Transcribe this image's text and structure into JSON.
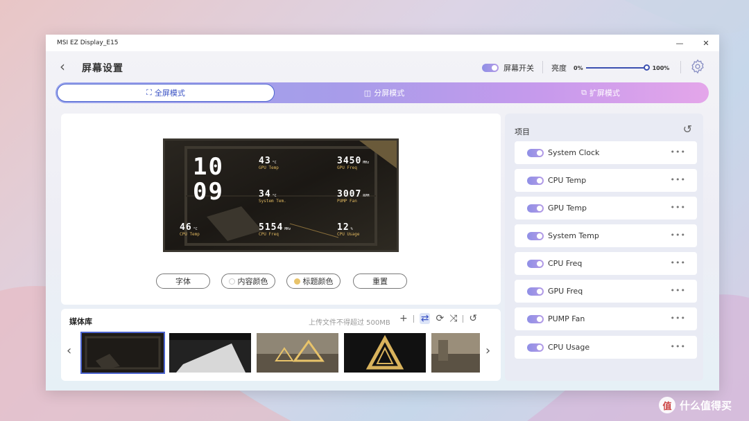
{
  "window": {
    "title": "MSI EZ Display_E15",
    "minimize": "—",
    "close": "✕"
  },
  "header": {
    "back": "‹",
    "title": "屏幕设置",
    "screen_switch_label": "屏幕开关",
    "brightness_label": "亮度",
    "brightness_min": "0%",
    "brightness_max": "100%",
    "brightness_value": 1.0
  },
  "tabs": [
    {
      "label": "全屏模式",
      "icon": "fullscreen-icon",
      "active": true
    },
    {
      "label": "分屏模式",
      "icon": "split-icon",
      "active": false
    },
    {
      "label": "扩屏模式",
      "icon": "extend-icon",
      "active": false
    }
  ],
  "preview": {
    "clock_hour": "10",
    "clock_min": "09",
    "stats": [
      {
        "value": "43",
        "unit": "°C",
        "label": "GPU Temp"
      },
      {
        "value": "3450",
        "unit": "MHz",
        "label": "GPU Freq"
      },
      {
        "value": "34",
        "unit": "°C",
        "label": "System Tem."
      },
      {
        "value": "3007",
        "unit": "RPM",
        "label": "PUMP Fan"
      },
      {
        "value": "46",
        "unit": "°C",
        "label": "CPU Temp"
      },
      {
        "value": "5154",
        "unit": "MHz",
        "label": "CPU Freq"
      },
      {
        "value": "12",
        "unit": "%",
        "label": "CPU Usage"
      }
    ],
    "buttons": {
      "font": "字体",
      "content_color": "内容颜色",
      "title_color": "标题颜色",
      "reset": "重置"
    }
  },
  "media": {
    "title": "媒体库",
    "hint": "上传文件不得超过 500MB",
    "add": "+",
    "prev": "‹",
    "next": "›"
  },
  "items_panel": {
    "title": "项目",
    "more": "•••",
    "items": [
      {
        "label": "System Clock"
      },
      {
        "label": "CPU Temp"
      },
      {
        "label": "GPU Temp"
      },
      {
        "label": "System Temp"
      },
      {
        "label": "CPU Freq"
      },
      {
        "label": "GPU Freq"
      },
      {
        "label": "PUMP Fan"
      },
      {
        "label": "CPU Usage"
      }
    ]
  },
  "watermark": {
    "logo": "值",
    "text": "什么值得买"
  },
  "colors": {
    "accent": "#4c64cf",
    "gold": "#e8c36a"
  }
}
